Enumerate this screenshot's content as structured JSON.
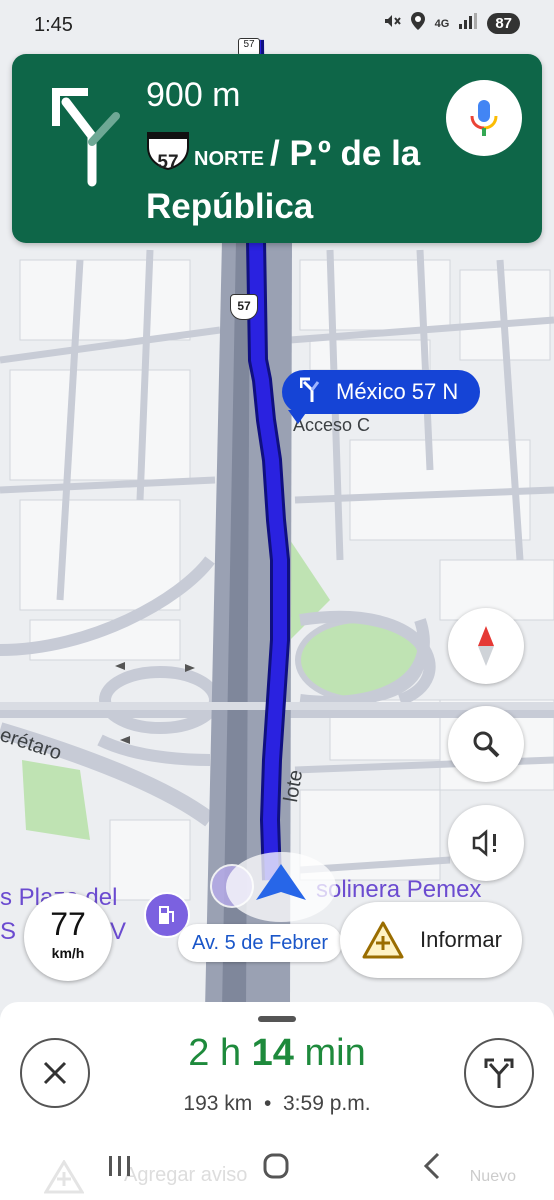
{
  "status_bar": {
    "time": "1:45",
    "network": "4G",
    "battery": "87"
  },
  "navigation": {
    "distance": "900 m",
    "route_shield": "57",
    "direction": "NORTE",
    "road_name": "/ P.º de la República"
  },
  "map": {
    "route_label": "México 57 N",
    "labels": {
      "acceso": "Acceso C",
      "queretaro": "erétaro",
      "lote": "lote",
      "plaza": "s Plaza del",
      "plaza2": "S",
      "v": "V",
      "gas": "solinera Pemex"
    },
    "highway_shields": [
      "57",
      "57"
    ],
    "current_street": "Av. 5 de Febrer",
    "colors": {
      "route": "#1a1fcf",
      "nav_card": "#0e6648"
    }
  },
  "speedometer": {
    "value": "77",
    "unit": "km/h"
  },
  "report_button": {
    "label": "Informar"
  },
  "trip": {
    "eta_hours": "2",
    "eta_h_label": "h",
    "eta_minutes": "14",
    "eta_min_label": "min",
    "distance": "193 km",
    "separator": "•",
    "arrival": "3:59 p.m."
  },
  "behind_sheet": {
    "add_report": "Agregar aviso",
    "new_badge": "Nuevo"
  }
}
